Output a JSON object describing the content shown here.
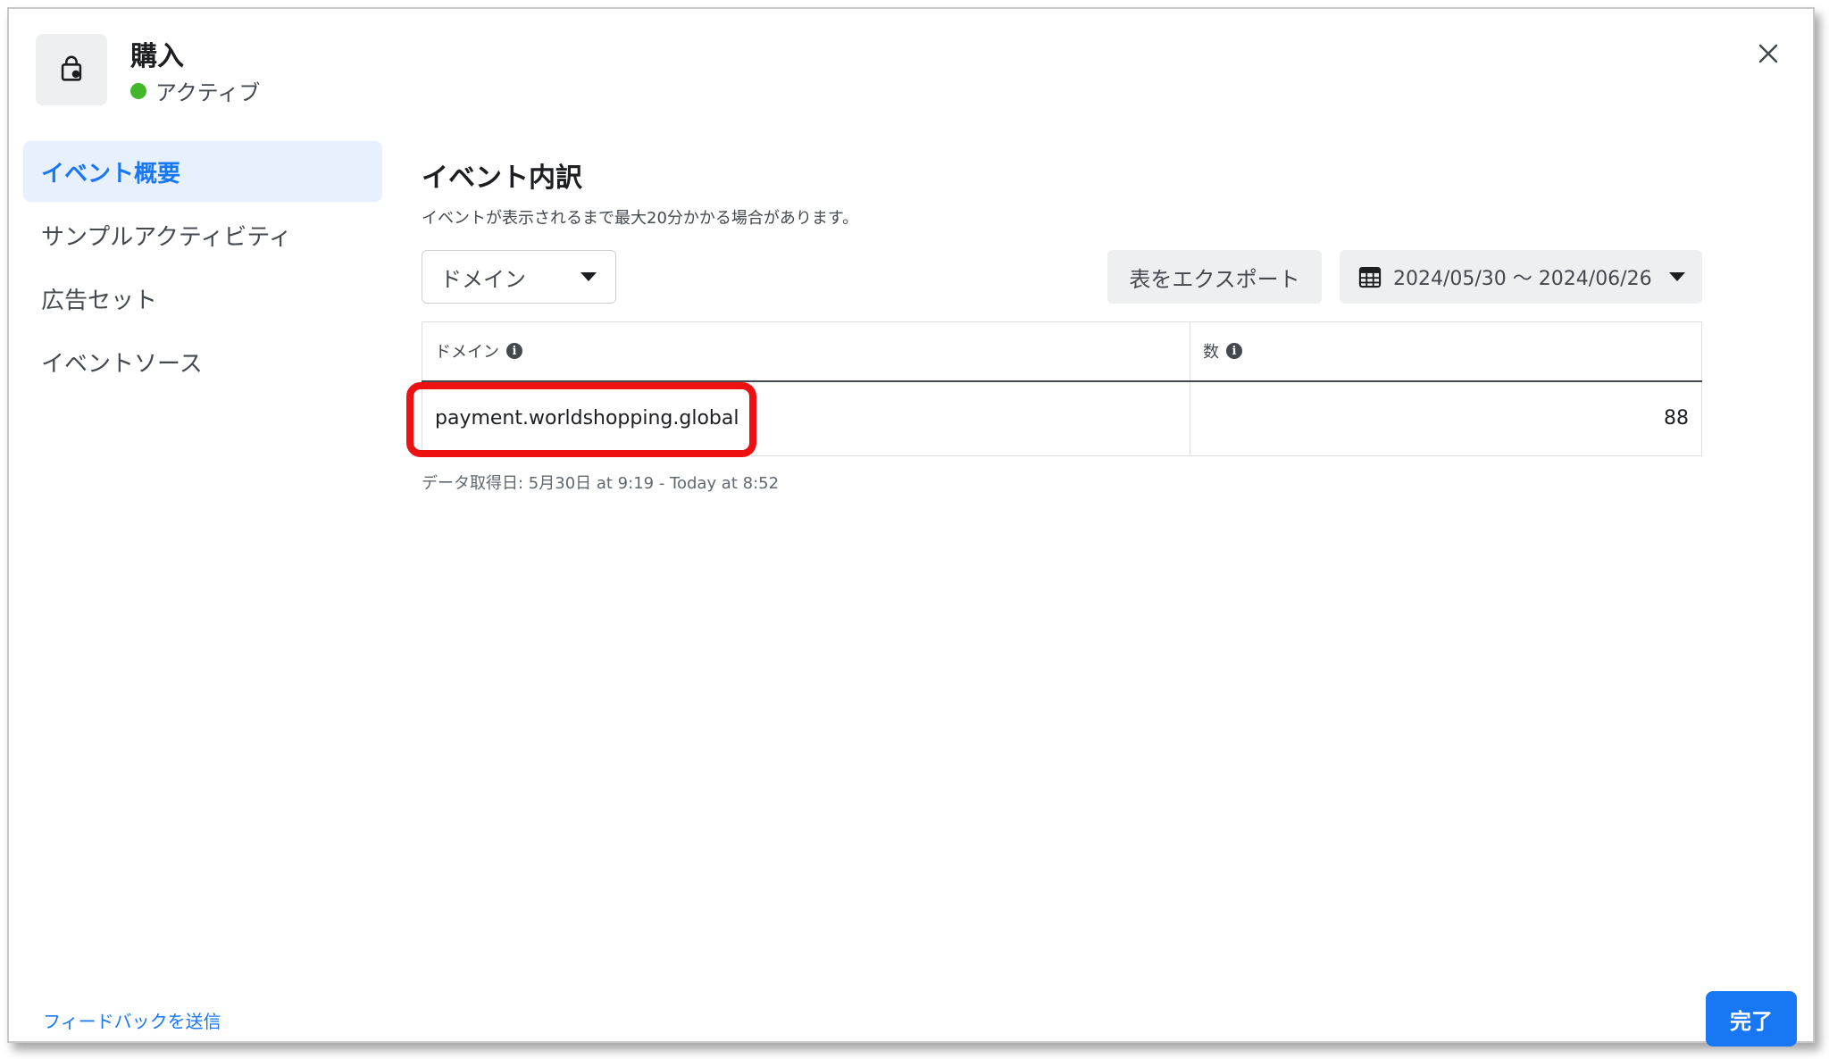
{
  "header": {
    "title": "購入",
    "status_label": "アクティブ",
    "status_color": "#42b72a",
    "icon": "shopping-bag-icon"
  },
  "sidebar": {
    "items": [
      {
        "label": "イベント概要",
        "active": true
      },
      {
        "label": "サンプルアクティビティ",
        "active": false
      },
      {
        "label": "広告セット",
        "active": false
      },
      {
        "label": "イベントソース",
        "active": false
      }
    ]
  },
  "main": {
    "title": "イベント内訳",
    "description": "イベントが表示されるまで最大20分かかる場合があります。",
    "breakdown_dropdown": {
      "selected": "ドメイン"
    },
    "export_label": "表をエクスポート",
    "date_range": "2024/05/30 ～ 2024/06/26",
    "table": {
      "columns": [
        "ドメイン",
        "数"
      ],
      "rows": [
        {
          "domain": "payment.worldshopping.global",
          "count": "88"
        }
      ]
    },
    "retrieved_text": "データ取得日: 5月30日 at 9:19 - Today at 8:52"
  },
  "footer": {
    "feedback_label": "フィードバックを送信",
    "done_label": "完了"
  },
  "colors": {
    "accent": "#1877f2",
    "highlight": "#ee1111"
  }
}
